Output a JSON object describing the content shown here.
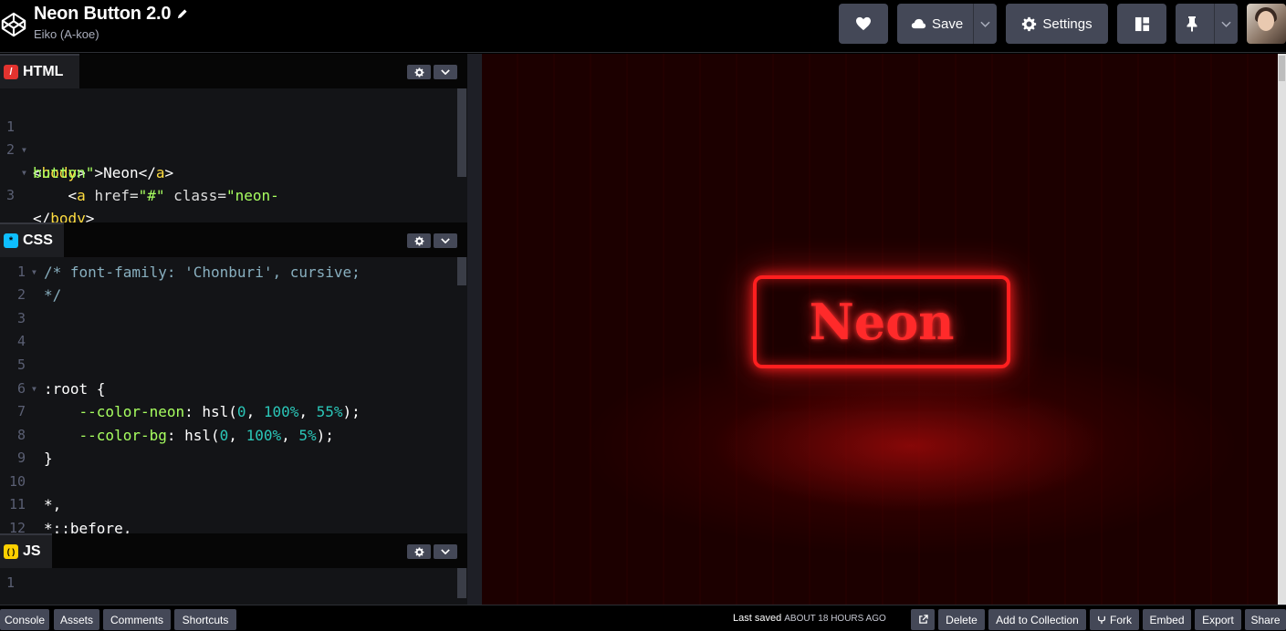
{
  "header": {
    "title": "Neon Button 2.0",
    "author": "Eiko (A-koe)",
    "save_label": "Save",
    "settings_label": "Settings"
  },
  "editors": {
    "html": {
      "label": "HTML",
      "icon_glyph": "/",
      "lines": [
        {
          "n": "1",
          "fold": true
        },
        {
          "n": "2",
          "fold": true
        },
        {
          "n": "",
          "fold": false
        },
        {
          "n": "3",
          "fold": false
        }
      ],
      "code": {
        "l1_open": "<",
        "l1_tag": "body",
        "l1_close": ">",
        "l2_open": "    <",
        "l2_tag": "a",
        "l2_attr1": " href=",
        "l2_str1": "\"#\"",
        "l2_attr2": " class=",
        "l2_str2": "\"neon-",
        "l3_str": "button\"",
        "l3_gt": ">",
        "l3_text": "Neon",
        "l3_close_open": "</",
        "l3_tag": "a",
        "l3_close": ">",
        "l4_open": "</",
        "l4_tag": "body",
        "l4_close": ">"
      }
    },
    "css": {
      "label": "CSS",
      "icon_glyph": "*",
      "line_numbers": [
        "1",
        "2",
        "3",
        "4",
        "5",
        "6",
        "7",
        "8",
        "9",
        "10",
        "11",
        "12"
      ],
      "code": {
        "l1": "/* font-family: 'Chonburi', cursive;",
        "l2": "*/",
        "l6_sel": ":root",
        "l6_brace": " {",
        "l7_prop": "    --color-neon",
        "l7_fn": ": hsl(",
        "l7_n1": "0",
        "l7_c1": ", ",
        "l7_n2": "100%",
        "l7_c2": ", ",
        "l7_n3": "55%",
        "l7_end": ");",
        "l8_prop": "    --color-bg",
        "l8_fn": ": hsl(",
        "l8_n1": "0",
        "l8_c1": ", ",
        "l8_n2": "100%",
        "l8_c2": ", ",
        "l8_n3": "5%",
        "l8_end": ");",
        "l9": "}",
        "l11": "*,",
        "l12": "*::before,"
      }
    },
    "js": {
      "label": "JS",
      "icon_glyph": "( )",
      "line_numbers": [
        "1"
      ]
    }
  },
  "preview": {
    "button_text": "Neon",
    "neon_color": "#ff1f1f"
  },
  "footer": {
    "console": "Console",
    "assets": "Assets",
    "comments": "Comments",
    "shortcuts": "Shortcuts",
    "last_saved_prefix": "Last saved",
    "last_saved_time": "ABOUT 18 HOURS AGO",
    "delete": "Delete",
    "add_to_collection": "Add to Collection",
    "fork": "Fork",
    "embed": "Embed",
    "export": "Export",
    "share": "Share"
  },
  "colors": {
    "html_icon": "#e3332f",
    "css_icon": "#0ebeff",
    "js_icon": "#fcd000"
  }
}
